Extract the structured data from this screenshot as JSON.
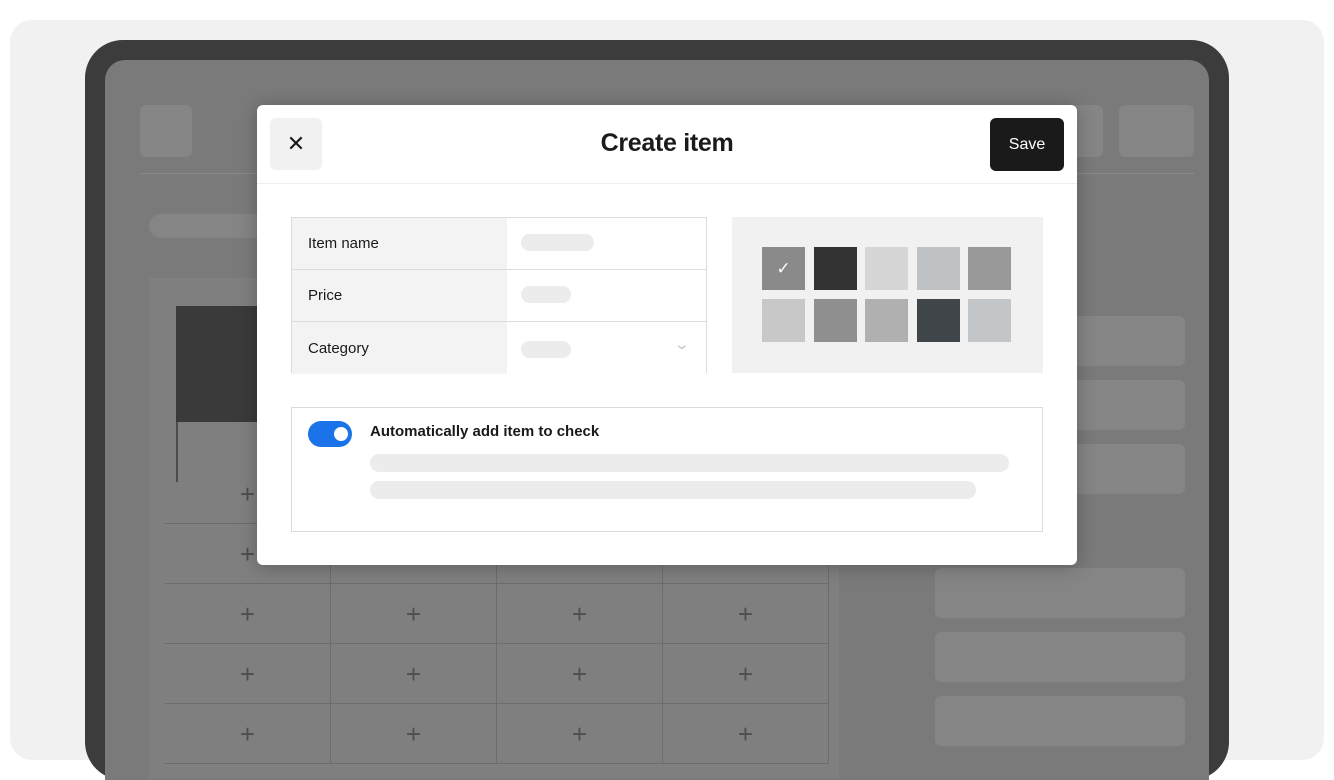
{
  "modal": {
    "title": "Create item",
    "close_icon": "close-icon",
    "close_glyph": "✕",
    "save_label": "Save"
  },
  "form": {
    "fields": [
      {
        "label": "Item name"
      },
      {
        "label": "Price"
      },
      {
        "label": "Category",
        "has_dropdown": true
      }
    ],
    "dropdown_icon": "chevron-down-icon",
    "chevron_glyph": "⌄"
  },
  "color_picker": {
    "check_glyph": "✓",
    "selected_index": 0,
    "swatches": [
      "#8a8a8a",
      "#333333",
      "#d6d6d6",
      "#bfc2c5",
      "#999999",
      "#c8c8c8",
      "#8f8f8f",
      "#b0b0b0",
      "#40454a",
      "#c3c6c9"
    ]
  },
  "auto_add": {
    "enabled": true,
    "label": "Automatically add item to check"
  },
  "background_grid": {
    "add_glyph": "+"
  },
  "colors": {
    "toggle_on": "#1a73e8",
    "save_button": "#1a1a1a"
  }
}
